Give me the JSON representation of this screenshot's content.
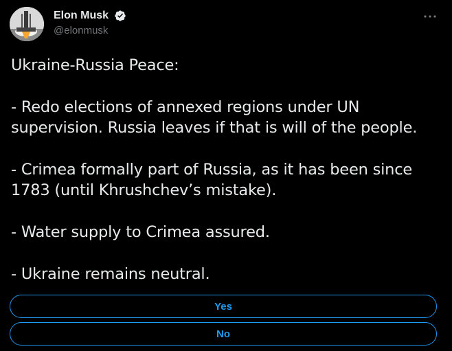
{
  "author": {
    "display_name": "Elon Musk",
    "handle": "@elonmusk",
    "verified": true,
    "avatar_icon": "avatar-rocket-launch"
  },
  "tweet": {
    "paragraphs": [
      "Ukraine-Russia Peace:",
      "- Redo elections of annexed regions under UN supervision. Russia leaves if that is will of the people.",
      "- Crimea formally part of Russia, as it has been since 1783 (until Khrushchev’s mistake).",
      "- Water supply to Crimea assured.",
      "- Ukraine remains neutral."
    ]
  },
  "poll": {
    "options": [
      "Yes",
      "No"
    ]
  },
  "colors": {
    "background": "#000000",
    "text": "#e7e9ea",
    "secondary_text": "#71767b",
    "accent": "#1d9bf0"
  }
}
